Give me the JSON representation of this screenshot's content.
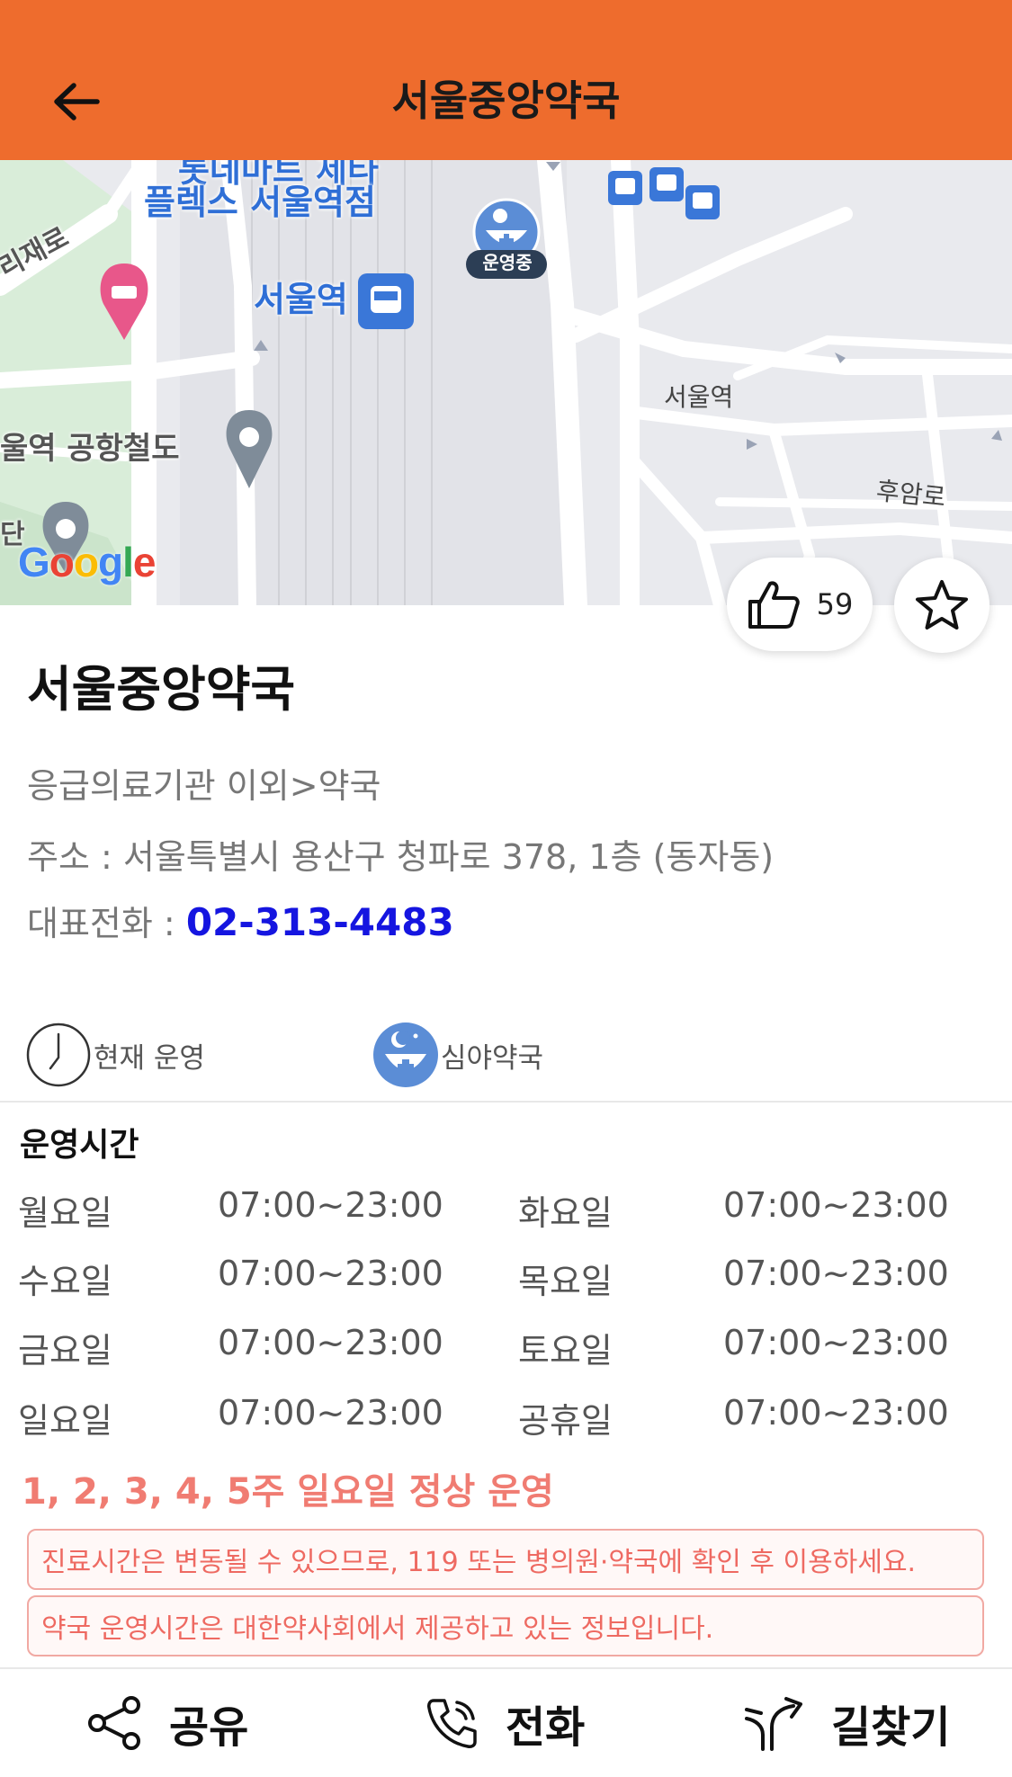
{
  "header": {
    "title": "서울중앙약국"
  },
  "map": {
    "labels": {
      "hotel_top": "롯데마트 제타",
      "hotel_bottom": "플렉스 서울역점",
      "road_left": "리재로",
      "station": "서울역",
      "pharmacy_badge": "운영중",
      "airport": "울역 공항철도",
      "station_small": "서울역",
      "road_right": "후암로",
      "partial_left": "단"
    },
    "google": {
      "g1": "G",
      "o1": "o",
      "o2": "o",
      "g2": "g",
      "l": "l",
      "e": "e"
    }
  },
  "like": {
    "count": "59"
  },
  "place": {
    "name": "서울중앙약국",
    "category": "응급의료기관 이외>약국",
    "address": "주소 : 서울특별시 용산구 청파로 378, 1층 (동자동)",
    "phone_label": "대표전화 : ",
    "phone": "02-313-4483"
  },
  "status": {
    "operating": "현재 운영",
    "night": "심야약국"
  },
  "hours": {
    "title": "운영시간",
    "rows": [
      {
        "day1": "월요일",
        "time1": "07:00~23:00",
        "day2": "화요일",
        "time2": "07:00~23:00"
      },
      {
        "day1": "수요일",
        "time1": "07:00~23:00",
        "day2": "목요일",
        "time2": "07:00~23:00"
      },
      {
        "day1": "금요일",
        "time1": "07:00~23:00",
        "day2": "토요일",
        "time2": "07:00~23:00"
      },
      {
        "day1": "일요일",
        "time1": "07:00~23:00",
        "day2": "공휴일",
        "time2": "07:00~23:00"
      }
    ],
    "sunday_note": "1, 2, 3, 4, 5주 일요일 정상 운영"
  },
  "notices": [
    "진료시간은 변동될 수 있으므로, 119 또는 병의원·약국에 확인 후 이용하세요.",
    "약국 운영시간은 대한약사회에서 제공하고 있는 정보입니다."
  ],
  "bottom": {
    "share": "공유",
    "call": "전화",
    "directions": "길찾기"
  },
  "colors": {
    "header": "#EE6C2D",
    "phone": "#1515E0",
    "notice": "#EE6A62",
    "night_icon": "#5B8DD6"
  }
}
